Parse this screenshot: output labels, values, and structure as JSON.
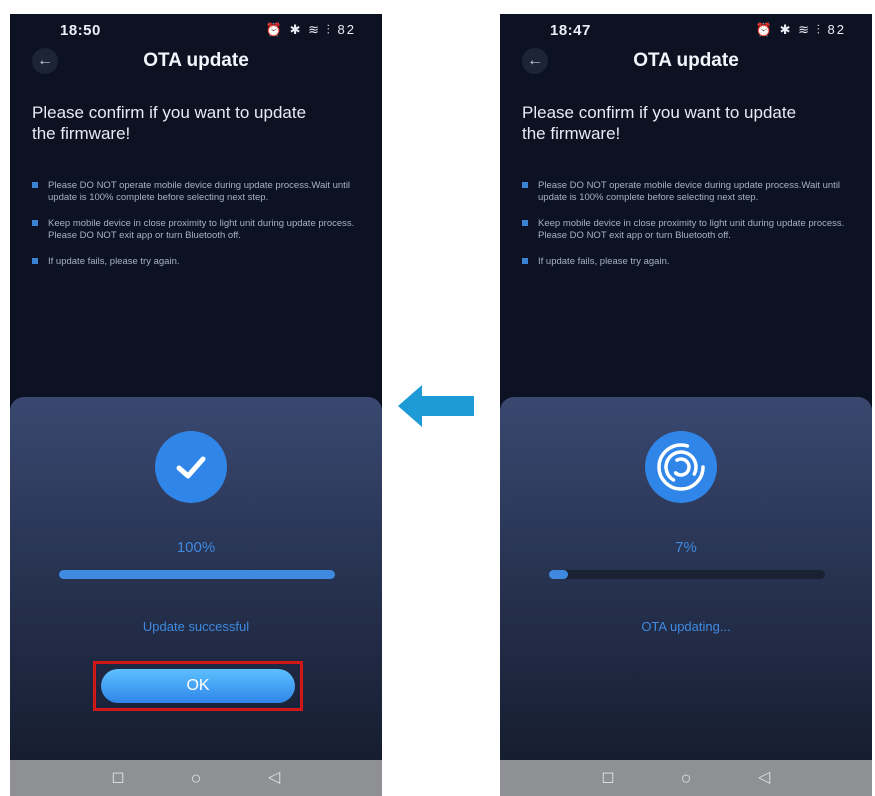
{
  "left_screen": {
    "status_time": "18:50",
    "status_icons": "⏰ ✱ ≋ ⫶ 82",
    "title": "OTA update",
    "confirm_text": "Please confirm if you want to update the firmware!",
    "notes": [
      "Please DO NOT operate mobile device during update process.Wait until update is 100% complete before selecting next step.",
      "Keep mobile device in close proximity to light unit during update process. Please DO NOT exit app or turn Bluetooth off.",
      "If update fails, please try again."
    ],
    "progress_percent": 100,
    "percent_label": "100%",
    "status_text": "Update successful",
    "ok_label": "OK"
  },
  "right_screen": {
    "status_time": "18:47",
    "status_icons": "⏰ ✱ ≋ ⫶ 82",
    "title": "OTA update",
    "confirm_text": "Please confirm if you want to update the firmware!",
    "notes": [
      "Please DO NOT operate mobile device during update process.Wait until update is 100% complete before selecting next step.",
      "Keep mobile device in close proximity to light unit during update process. Please DO NOT exit app or turn Bluetooth off.",
      "If update fails, please try again."
    ],
    "progress_percent": 7,
    "percent_label": "7%",
    "status_text": "OTA updating..."
  },
  "colors": {
    "accent_blue": "#2f86e8",
    "highlight_red": "#d01818",
    "arrow_blue": "#1e9ad6"
  },
  "icons": {
    "success": "checkmark-icon",
    "updating": "ota-spinner-icon",
    "transition": "left-arrow-icon"
  }
}
